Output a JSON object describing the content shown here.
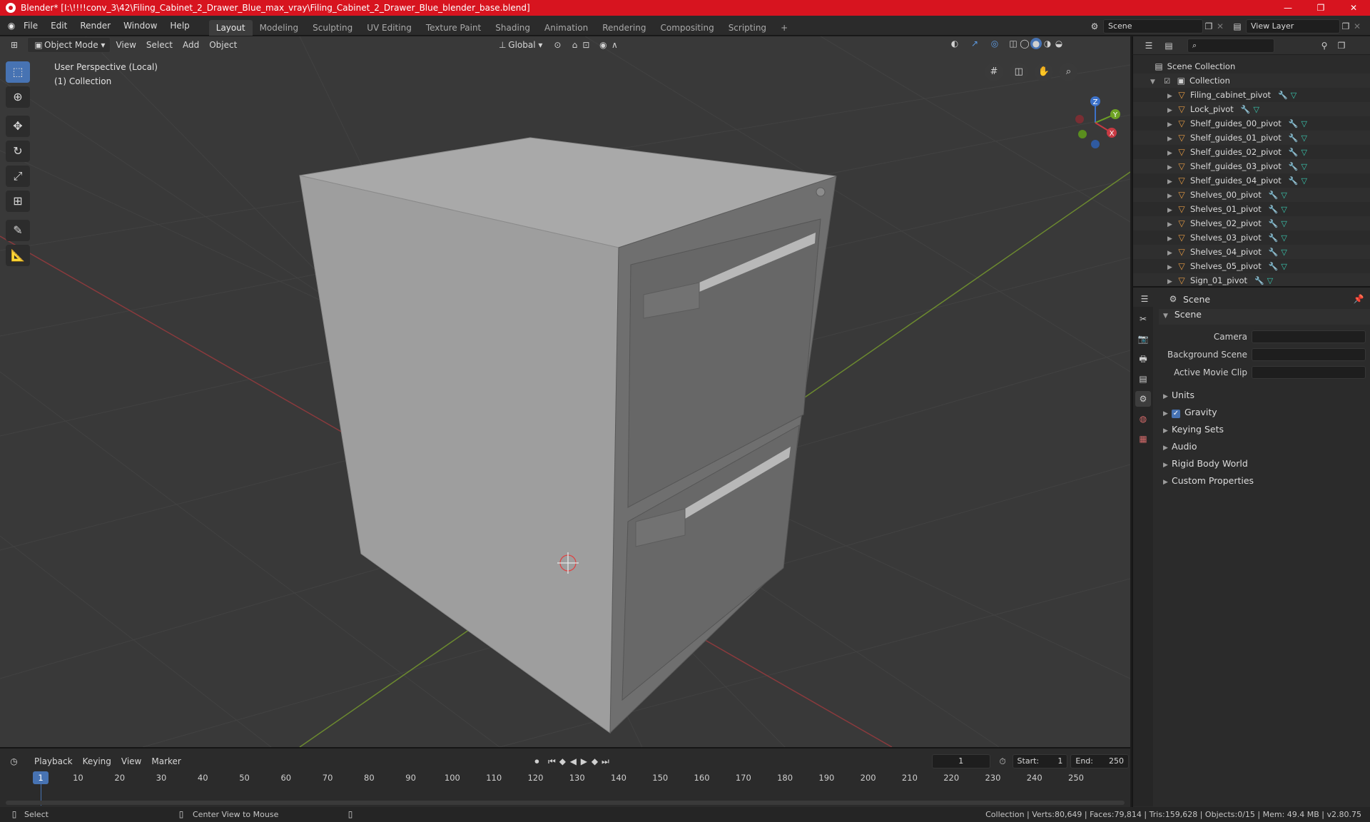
{
  "window": {
    "title": "Blender* [I:\\!!!!conv_3\\42\\Filing_Cabinet_2_Drawer_Blue_max_vray\\Filing_Cabinet_2_Drawer_Blue_blender_base.blend]",
    "controls": [
      "—",
      "❐",
      "✕"
    ]
  },
  "menu": [
    "File",
    "Edit",
    "Render",
    "Window",
    "Help"
  ],
  "workspaces": [
    "Layout",
    "Modeling",
    "Sculpting",
    "UV Editing",
    "Texture Paint",
    "Shading",
    "Animation",
    "Rendering",
    "Compositing",
    "Scripting"
  ],
  "workspace_add": "+",
  "scene_selector": "Scene",
  "view_layer": "View Layer",
  "viewport_header": {
    "mode": "Object Mode",
    "menus": [
      "View",
      "Select",
      "Add",
      "Object"
    ],
    "transform_orientation": "Global"
  },
  "viewport": {
    "perspective": "User Perspective (Local)",
    "collection": "(1) Collection",
    "gizmo": {
      "x": "X",
      "y": "Y",
      "z": "Z"
    }
  },
  "outliner": {
    "root": "Scene Collection",
    "collection": "Collection",
    "objects": [
      "Filing_cabinet_pivot",
      "Lock_pivot",
      "Shelf_guides_00_pivot",
      "Shelf_guides_01_pivot",
      "Shelf_guides_02_pivot",
      "Shelf_guides_03_pivot",
      "Shelf_guides_04_pivot",
      "Shelves_00_pivot",
      "Shelves_01_pivot",
      "Shelves_02_pivot",
      "Shelves_03_pivot",
      "Shelves_04_pivot",
      "Shelves_05_pivot",
      "Sign_01_pivot"
    ]
  },
  "properties": {
    "context": "Scene",
    "panel": "Scene",
    "fields": [
      {
        "label": "Camera",
        "value": ""
      },
      {
        "label": "Background Scene",
        "value": ""
      },
      {
        "label": "Active Movie Clip",
        "value": ""
      }
    ],
    "subpanels": [
      "Units",
      "Gravity",
      "Keying Sets",
      "Audio",
      "Rigid Body World",
      "Custom Properties"
    ],
    "gravity_checked": true
  },
  "timeline": {
    "menus": [
      "Playback",
      "Keying",
      "View",
      "Marker"
    ],
    "current_frame": "1",
    "start_label": "Start:",
    "start": "1",
    "end_label": "End:",
    "end": "250",
    "ruler": [
      "10",
      "20",
      "30",
      "40",
      "50",
      "60",
      "70",
      "80",
      "90",
      "100",
      "110",
      "120",
      "130",
      "140",
      "150",
      "160",
      "170",
      "180",
      "190",
      "200",
      "210",
      "220",
      "230",
      "240",
      "250"
    ]
  },
  "status": {
    "left": "Select",
    "middle": "Center View to Mouse",
    "stats": "Collection | Verts:80,649 | Faces:79,814 | Tris:159,628 | Objects:0/15 | Mem: 49.4 MB | v2.80.75"
  },
  "colors": {
    "accent": "#4773b3",
    "titlebar": "#d7141f",
    "object_icon": "#e59a43"
  }
}
